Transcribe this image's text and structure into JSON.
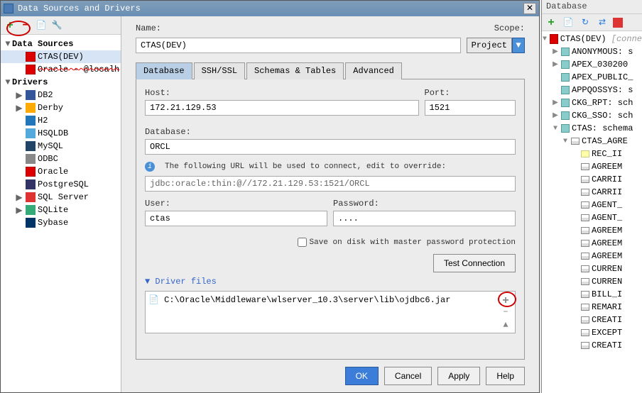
{
  "dialog": {
    "title": "Data Sources and Drivers",
    "name_label": "Name:",
    "scope_label": "Scope:",
    "name_value": "CTAS(DEV)",
    "scope_value": "Project",
    "tabs": {
      "database": "Database",
      "ssh": "SSH/SSL",
      "schemas": "Schemas & Tables",
      "advanced": "Advanced"
    },
    "fields": {
      "host_label": "Host:",
      "host_value": "172.21.129.53",
      "port_label": "Port:",
      "port_value": "1521",
      "database_label": "Database:",
      "database_value": "ORCL",
      "url_info": "The following URL will be used to connect, edit to override:",
      "url_value": "jdbc:oracle:thin:@//172.21.129.53:1521/ORCL",
      "user_label": "User:",
      "user_value": "ctas",
      "password_label": "Password:",
      "password_value": "....",
      "save_disk_label": "Save on disk with master password protection",
      "test_label": "Test Connection"
    },
    "driver": {
      "header": "Driver files",
      "path": "C:\\Oracle\\Middleware\\wlserver_10.3\\server\\lib\\ojdbc6.jar"
    },
    "buttons": {
      "ok": "OK",
      "cancel": "Cancel",
      "apply": "Apply",
      "help": "Help"
    },
    "tree": {
      "data_sources": "Data Sources",
      "ctas": "CTAS(DEV)",
      "oracle_local": "Oracle - @localh",
      "drivers": "Drivers",
      "items": [
        "DB2",
        "Derby",
        "H2",
        "HSQLDB",
        "MySQL",
        "ODBC",
        "Oracle",
        "PostgreSQL",
        "SQL Server",
        "SQLite",
        "Sybase"
      ]
    }
  },
  "side": {
    "title": "Database",
    "root": "CTAS(DEV)",
    "root_note": "[conne",
    "schemas": [
      "ANONYMOUS: s",
      "APEX_030200",
      "APEX_PUBLIC_",
      "APPQOSSYS: s",
      "CKG_RPT: sch",
      "CKG_SSO: sch"
    ],
    "ctas_label": "CTAS: schema",
    "ctas_table": "CTAS_AGRE",
    "columns": [
      "REC_II",
      "AGREEM",
      "CARRII",
      "CARRII",
      "AGENT_",
      "AGENT_",
      "AGREEM",
      "AGREEM",
      "AGREEM",
      "CURREN",
      "CURREN",
      "BILL_I",
      "REMARI",
      "CREATI",
      "EXCEPT",
      "CREATI"
    ]
  }
}
